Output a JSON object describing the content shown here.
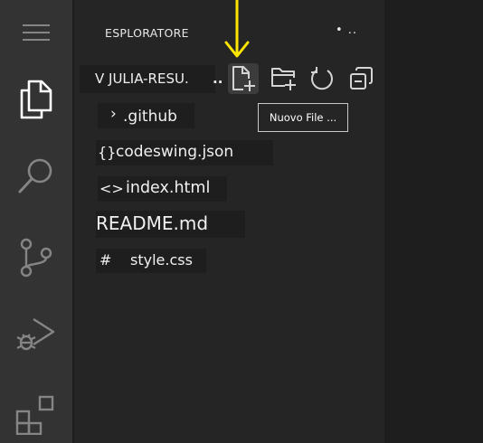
{
  "activity_bar": {
    "items": [
      {
        "icon": "menu-icon"
      },
      {
        "icon": "explorer-icon"
      },
      {
        "icon": "search-icon"
      },
      {
        "icon": "source-control-icon"
      },
      {
        "icon": "run-debug-icon"
      },
      {
        "icon": "extensions-icon"
      }
    ]
  },
  "explorer": {
    "title": "ESPLORATORE",
    "more": "• ..",
    "folder": {
      "label": "V JULIA-RESU.",
      "overflow": ".."
    },
    "toolbar": {
      "new_file": "new-file-icon",
      "new_folder": "new-folder-icon",
      "refresh": "refresh-icon",
      "collapse": "collapse-all-icon"
    },
    "tooltip": "Nuovo File ...",
    "files": [
      {
        "icon": "›",
        "name": ".github"
      },
      {
        "icon": "{}",
        "name": "codeswing.json"
      },
      {
        "icon": "<>",
        "name": "index.html"
      },
      {
        "icon": "",
        "name": "README.md"
      },
      {
        "icon": "#",
        "name": "style.css"
      }
    ]
  },
  "colors": {
    "activity_bar": "#333333",
    "sidebar": "#252526",
    "editor": "#1e1e1e",
    "annotation_arrow": "#ffe600"
  }
}
